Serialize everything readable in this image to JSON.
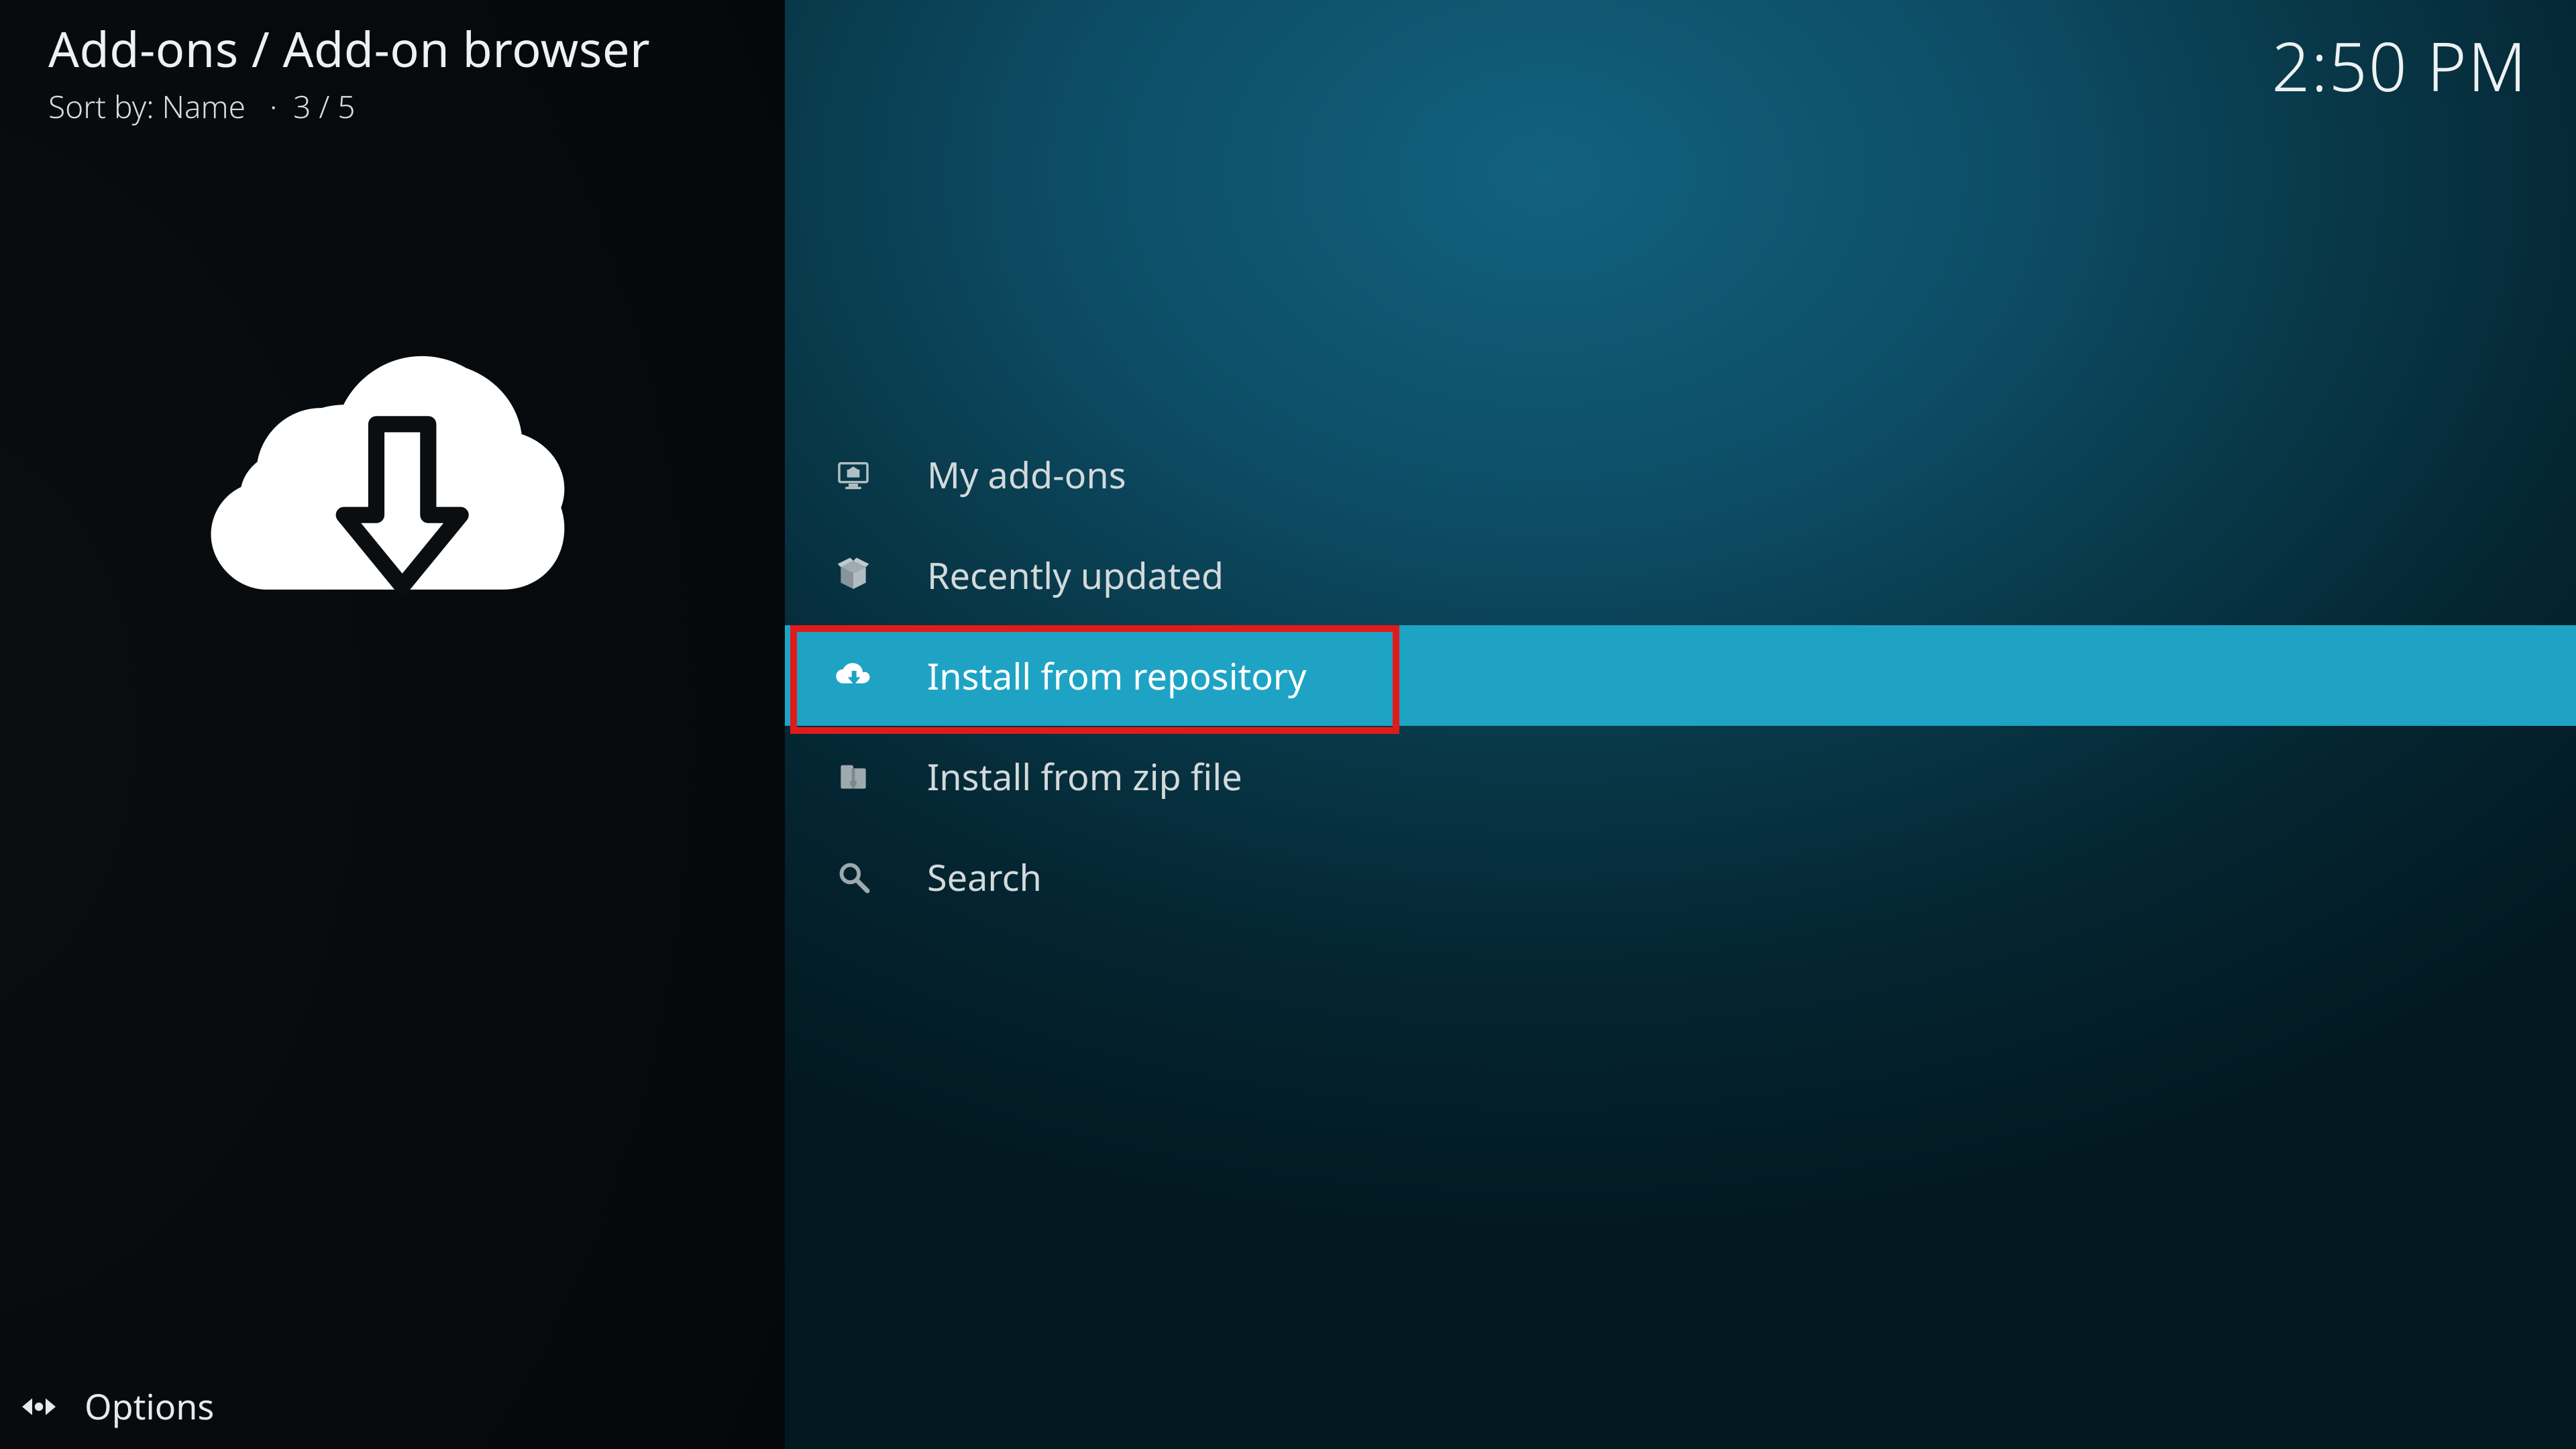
{
  "header": {
    "breadcrumb": "Add-ons / Add-on browser",
    "sort_label": "Sort by: Name",
    "position": "3 / 5",
    "separator": "·",
    "clock": "2:50 PM"
  },
  "sidebar": {
    "main_icon": "cloud-download-icon"
  },
  "menu": {
    "items": [
      {
        "icon": "monitor-box-icon",
        "label": "My add-ons",
        "selected": false
      },
      {
        "icon": "open-box-icon",
        "label": "Recently updated",
        "selected": false
      },
      {
        "icon": "cloud-down-icon",
        "label": "Install from repository",
        "selected": true
      },
      {
        "icon": "zip-file-icon",
        "label": "Install from zip file",
        "selected": false
      },
      {
        "icon": "search-icon",
        "label": "Search",
        "selected": false
      }
    ]
  },
  "footer": {
    "options_label": "Options",
    "options_icon": "sliders-icon"
  },
  "annotation": {
    "highlight_target_index": 2,
    "color": "#e11b1b"
  }
}
